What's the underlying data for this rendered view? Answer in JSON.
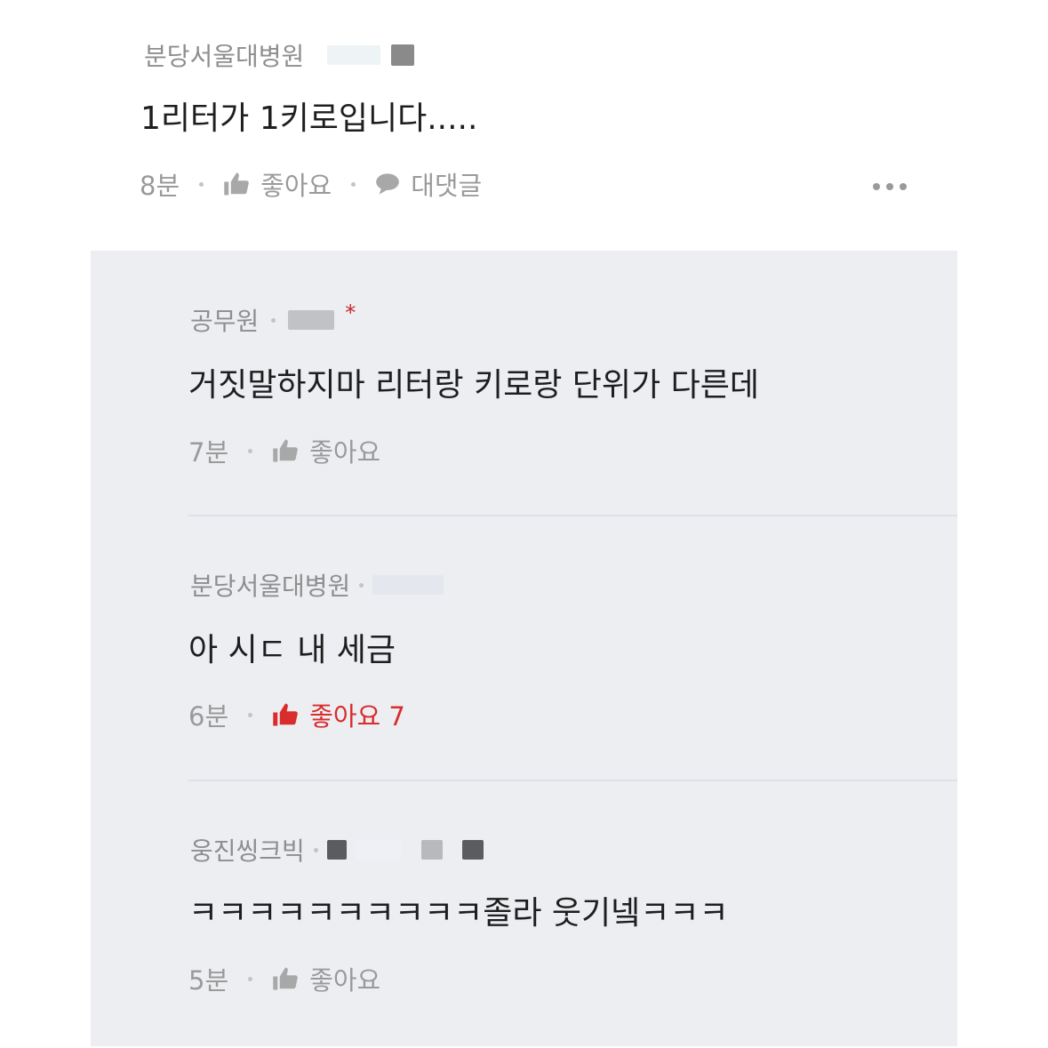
{
  "main_comment": {
    "author": "분당서울대병원",
    "text": "1리터가 1키로입니다.....",
    "time": "8분",
    "like_label": "좋아요",
    "reply_label": "대댓글"
  },
  "replies": [
    {
      "author": "공무원",
      "text": "거짓말하지마 리터랑 키로랑 단위가 다른데",
      "time": "7분",
      "like_label": "좋아요",
      "star": "*"
    },
    {
      "author": "분당서울대병원",
      "text": "아 시ㄷ 내 세금",
      "time": "6분",
      "like_label": "좋아요 7"
    },
    {
      "author": "웅진씽크빅",
      "text": "ㅋㅋㅋㅋㅋㅋㅋㅋㅋㅋ졸라 웃기넼ㅋㅋㅋ",
      "time": "5분",
      "like_label": "좋아요"
    }
  ],
  "icons": {
    "like": "thumbs-up-icon",
    "reply": "speech-bubble-icon",
    "more": "more-dots-icon"
  },
  "colors": {
    "liked": "#d92c2c",
    "reply_background": "#eceef2",
    "meta_text": "#9a9a9a",
    "author_text": "#8e8e8e"
  }
}
